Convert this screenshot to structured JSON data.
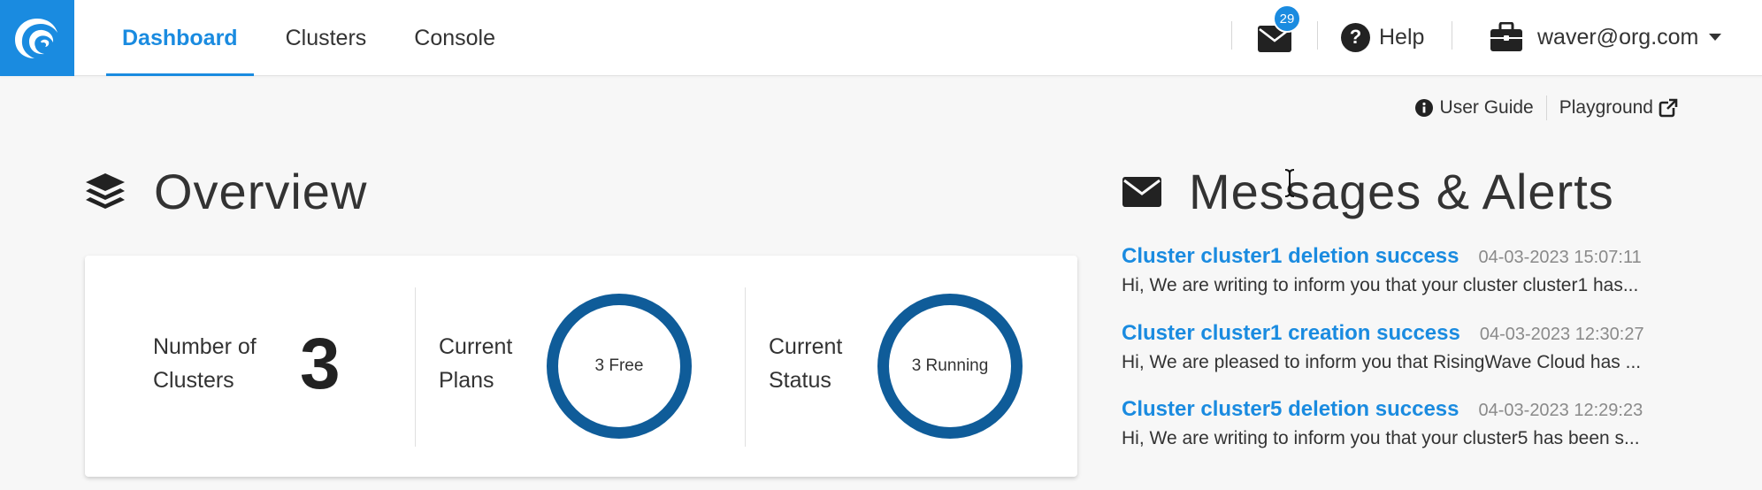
{
  "header": {
    "nav": [
      {
        "label": "Dashboard",
        "active": true
      },
      {
        "label": "Clusters",
        "active": false
      },
      {
        "label": "Console",
        "active": false
      }
    ],
    "mail_badge": "29",
    "help_label": "Help",
    "user_email": "waver@org.com",
    "accent_color": "#1a8be0"
  },
  "sublinks": {
    "user_guide": "User Guide",
    "playground": "Playground"
  },
  "overview": {
    "title": "Overview",
    "clusters_label_1": "Number of",
    "clusters_label_2": "Clusters",
    "clusters_count": "3",
    "plans_label_1": "Current",
    "plans_label_2": "Plans",
    "plans_value": "3 Free",
    "status_label_1": "Current",
    "status_label_2": "Status",
    "status_value": "3 Running",
    "ring_color": "#0f5c99"
  },
  "messages": {
    "title": "Messages & Alerts",
    "items": [
      {
        "title": "Cluster cluster1 deletion success",
        "time": "04-03-2023 15:07:11",
        "body": "Hi, We are writing to inform you that your cluster cluster1 has..."
      },
      {
        "title": "Cluster cluster1 creation success",
        "time": "04-03-2023 12:30:27",
        "body": "Hi, We are pleased to inform you that RisingWave Cloud has ..."
      },
      {
        "title": "Cluster cluster5 deletion success",
        "time": "04-03-2023 12:29:23",
        "body": "Hi, We are writing to inform you that your cluster5 has been s..."
      }
    ]
  }
}
